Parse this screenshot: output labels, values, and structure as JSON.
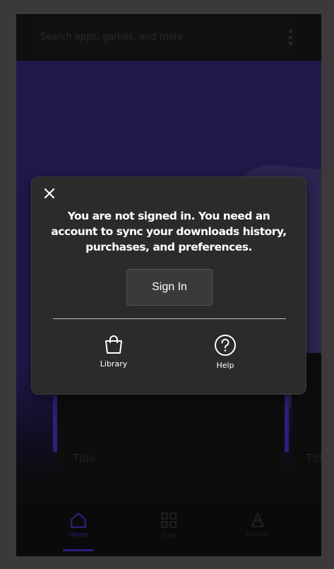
{
  "background": {
    "search_placeholder": "Search apps, games, and more",
    "card_titles": [
      "Title",
      "Title"
    ],
    "nav": [
      {
        "label": "Home",
        "icon": "home-icon"
      },
      {
        "label": "Apps",
        "icon": "apps-icon"
      },
      {
        "label": "Games",
        "icon": "games-icon"
      }
    ]
  },
  "dialog": {
    "message": "You are not signed in. You need an account to sync your downloads history, purchases, and preferences.",
    "sign_in_label": "Sign In",
    "actions": [
      {
        "label": "Library",
        "icon": "shopping-bag-icon"
      },
      {
        "label": "Help",
        "icon": "help-circle-icon"
      }
    ]
  },
  "colors": {
    "accent": "#3b2ea8",
    "hero": "#2d2569",
    "dialog_bg": "#2b2b2b",
    "button_bg": "#3a3a3a"
  }
}
